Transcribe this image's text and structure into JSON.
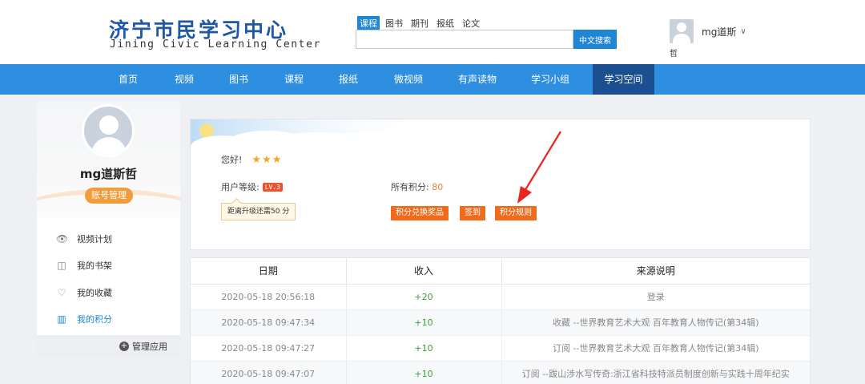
{
  "header": {
    "logo_cn": "济宁市民学习中心",
    "logo_en": "Jining Civic Learning Center",
    "search_tabs": [
      {
        "label": "课程",
        "active": true
      },
      {
        "label": "图书",
        "active": false
      },
      {
        "label": "期刊",
        "active": false
      },
      {
        "label": "报纸",
        "active": false
      },
      {
        "label": "论文",
        "active": false
      }
    ],
    "search_placeholder": "",
    "search_button": "中文搜索",
    "user_name": "mg道斯",
    "user_name_tail": "哲",
    "chevron": "∨"
  },
  "nav": [
    {
      "label": "首页",
      "active": false
    },
    {
      "label": "视频",
      "active": false
    },
    {
      "label": "图书",
      "active": false
    },
    {
      "label": "课程",
      "active": false
    },
    {
      "label": "报纸",
      "active": false
    },
    {
      "label": "微视频",
      "active": false
    },
    {
      "label": "有声读物",
      "active": false
    },
    {
      "label": "学习小组",
      "active": false
    },
    {
      "label": "学习空间",
      "active": true
    }
  ],
  "sidebar": {
    "name": "mg道斯哲",
    "manage_label": "账号管理",
    "items": [
      {
        "label": "视频计划",
        "icon": "eye-icon",
        "glyph": "👁",
        "active": false
      },
      {
        "label": "我的书架",
        "icon": "book-icon",
        "glyph": "◫",
        "active": false
      },
      {
        "label": "我的收藏",
        "icon": "heart-icon",
        "glyph": "♡",
        "active": false
      },
      {
        "label": "我的积分",
        "icon": "chart-icon",
        "glyph": "▥",
        "active": true
      }
    ],
    "manage_app": "管理应用",
    "plus_glyph": "+"
  },
  "points": {
    "greeting": "您好!",
    "stars": "★★★",
    "level_label": "用户等级:",
    "level_badge": "LV.3",
    "upgrade_text": "距离升级还需50 分",
    "total_label": "所有积分:",
    "total_value": "80",
    "buttons": {
      "exchange": "积分兑换奖品",
      "checkin": "签到",
      "rules": "积分规则"
    }
  },
  "table": {
    "headers": [
      "日期",
      "收入",
      "来源说明"
    ],
    "rows": [
      {
        "date": "2020-05-18 20:56:18",
        "income": "+20",
        "source": "登录"
      },
      {
        "date": "2020-05-18 09:47:34",
        "income": "+10",
        "source": "收藏 --世界教育艺术大观 百年教育人物传记(第34辑)"
      },
      {
        "date": "2020-05-18 09:47:27",
        "income": "+10",
        "source": "订阅 --世界教育艺术大观 百年教育人物传记(第34辑)"
      },
      {
        "date": "2020-05-18 09:47:07",
        "income": "+10",
        "source": "订阅 --跋山涉水写传奇:浙江省科技特派员制度创新与实践十周年纪实"
      }
    ]
  }
}
